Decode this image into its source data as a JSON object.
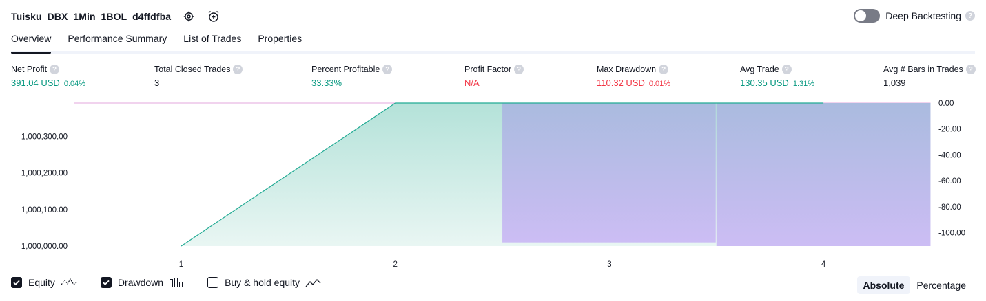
{
  "header": {
    "strategy_name": "Tuisku_DBX_1Min_1BOL_d4ffdfba",
    "deep_backtesting_label": "Deep Backtesting",
    "deep_backtesting_on": false,
    "help_glyph": "?"
  },
  "tabs": [
    {
      "label": "Overview",
      "active": true
    },
    {
      "label": "Performance Summary",
      "active": false
    },
    {
      "label": "List of Trades",
      "active": false
    },
    {
      "label": "Properties",
      "active": false
    }
  ],
  "metrics": {
    "net_profit": {
      "label": "Net Profit",
      "value": "391.04 USD",
      "pct": "0.04%",
      "tone": "positive"
    },
    "total_closed_trades": {
      "label": "Total Closed Trades",
      "value": "3"
    },
    "percent_profitable": {
      "label": "Percent Profitable",
      "value": "33.33%",
      "tone": "positive"
    },
    "profit_factor": {
      "label": "Profit Factor",
      "value": "N/A",
      "tone": "negative"
    },
    "max_drawdown": {
      "label": "Max Drawdown",
      "value": "110.32 USD",
      "pct": "0.01%",
      "tone": "negative"
    },
    "avg_trade": {
      "label": "Avg Trade",
      "value": "130.35 USD",
      "pct": "1.31%",
      "tone": "positive"
    },
    "avg_bars": {
      "label": "Avg # Bars in Trades",
      "value": "1,039"
    }
  },
  "chart_data": {
    "type": "area",
    "x_ticks": [
      "1",
      "2",
      "3",
      "4"
    ],
    "left_axis": {
      "ticks": [
        "1,000,000.00",
        "1,000,100.00",
        "1,000,200.00",
        "1,000,300.00"
      ],
      "values": [
        1000000,
        1000100,
        1000200,
        1000300
      ],
      "range": [
        1000000,
        1000391.04
      ]
    },
    "right_axis": {
      "ticks": [
        "0.00",
        "-20.00",
        "-40.00",
        "-60.00",
        "-80.00",
        "-100.00"
      ],
      "values": [
        0,
        -20,
        -40,
        -60,
        -80,
        -100
      ],
      "range": [
        -110.32,
        0
      ]
    },
    "equity": {
      "x": [
        1,
        2,
        3,
        4
      ],
      "y": [
        1000000,
        1000391.04,
        1000391.04,
        1000391.04
      ],
      "color": "#22ab94"
    },
    "drawdown": {
      "bars": [
        {
          "x_start": 2.5,
          "x_end": 3.5,
          "value": -107.5
        },
        {
          "x_start": 3.5,
          "x_end": 4.5,
          "value": -110.32
        }
      ],
      "color_top": "#a9b9df",
      "color_bottom": "#cbbdf4"
    },
    "buy_hold": {
      "x_start": 1,
      "x_end": 4.5,
      "value": 0,
      "color": "#e3a7de"
    },
    "grid": false
  },
  "footer": {
    "equity": {
      "label": "Equity",
      "checked": true
    },
    "drawdown": {
      "label": "Drawdown",
      "checked": true
    },
    "buy_hold": {
      "label": "Buy & hold equity",
      "checked": false
    },
    "modes": [
      {
        "label": "Absolute",
        "active": true
      },
      {
        "label": "Percentage",
        "active": false
      }
    ]
  },
  "colors": {
    "positive": "#089981",
    "negative": "#f23645",
    "text": "#131722"
  }
}
